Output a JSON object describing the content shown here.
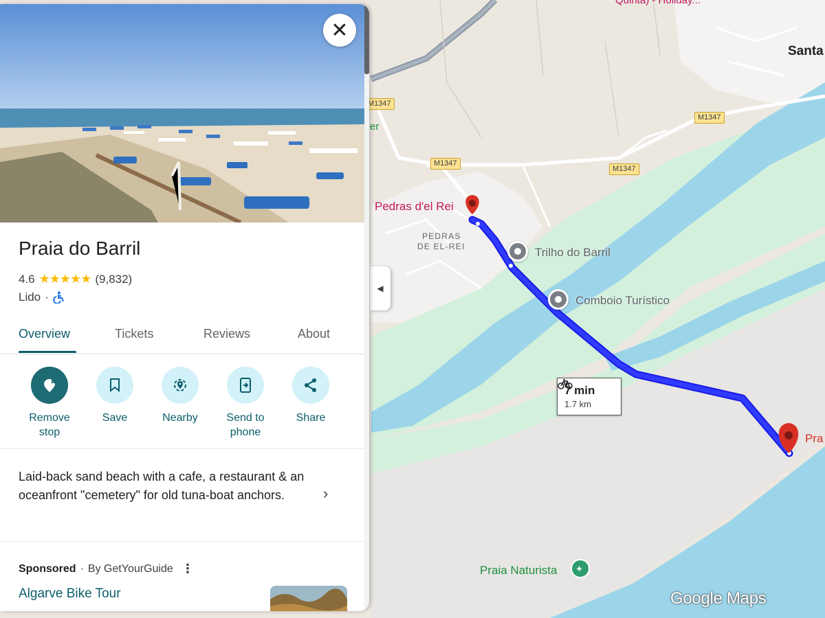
{
  "place": {
    "name": "Praia do Barril",
    "rating": "4.6",
    "stars": "★★★★★",
    "rating_value": 4.6,
    "reviews_count": "(9,832)",
    "category": "Lido",
    "separator": "·"
  },
  "tabs": [
    "Overview",
    "Tickets",
    "Reviews",
    "About"
  ],
  "actions": [
    {
      "label_1": "Remove",
      "label_2": "stop",
      "icon": "remove-stop-icon"
    },
    {
      "label_1": "Save",
      "label_2": "",
      "icon": "bookmark-icon"
    },
    {
      "label_1": "Nearby",
      "label_2": "",
      "icon": "nearby-icon"
    },
    {
      "label_1": "Send to",
      "label_2": "phone",
      "icon": "send-to-phone-icon"
    },
    {
      "label_1": "Share",
      "label_2": "",
      "icon": "share-icon"
    }
  ],
  "description": "Laid-back sand beach with a cafe, a restaurant & an oceanfront \"cemetery\" for old tuna-boat anchors.",
  "sponsored": {
    "label": "Sponsored",
    "by": "By GetYourGuide",
    "ad_title": "Algarve Bike Tour"
  },
  "map": {
    "labels": {
      "pedras_del_rei": "Pedras d'el Rei",
      "pedras_area_1": "PEDRAS",
      "pedras_area_2": "DE EL-REI",
      "trilho": "Trilho do Barril",
      "comboio": "Comboio Turístico",
      "praia_naturista": "Praia Naturista",
      "santa": "Santa",
      "pra": "Pra",
      "er": "er",
      "top_partial": "Quinta) - Holiday..."
    },
    "road_shields": [
      "M1347",
      "M1347",
      "M1347",
      "M1347"
    ],
    "route": {
      "time": "7 min",
      "distance": "1.7 km"
    },
    "logo": "Google Maps"
  },
  "colors": {
    "accent": "#0b5d6a",
    "route": "#1a1ae6",
    "water": "#9cd5ea",
    "land": "#ece8e0",
    "park": "#d6f2df",
    "pin": "#d93025"
  }
}
